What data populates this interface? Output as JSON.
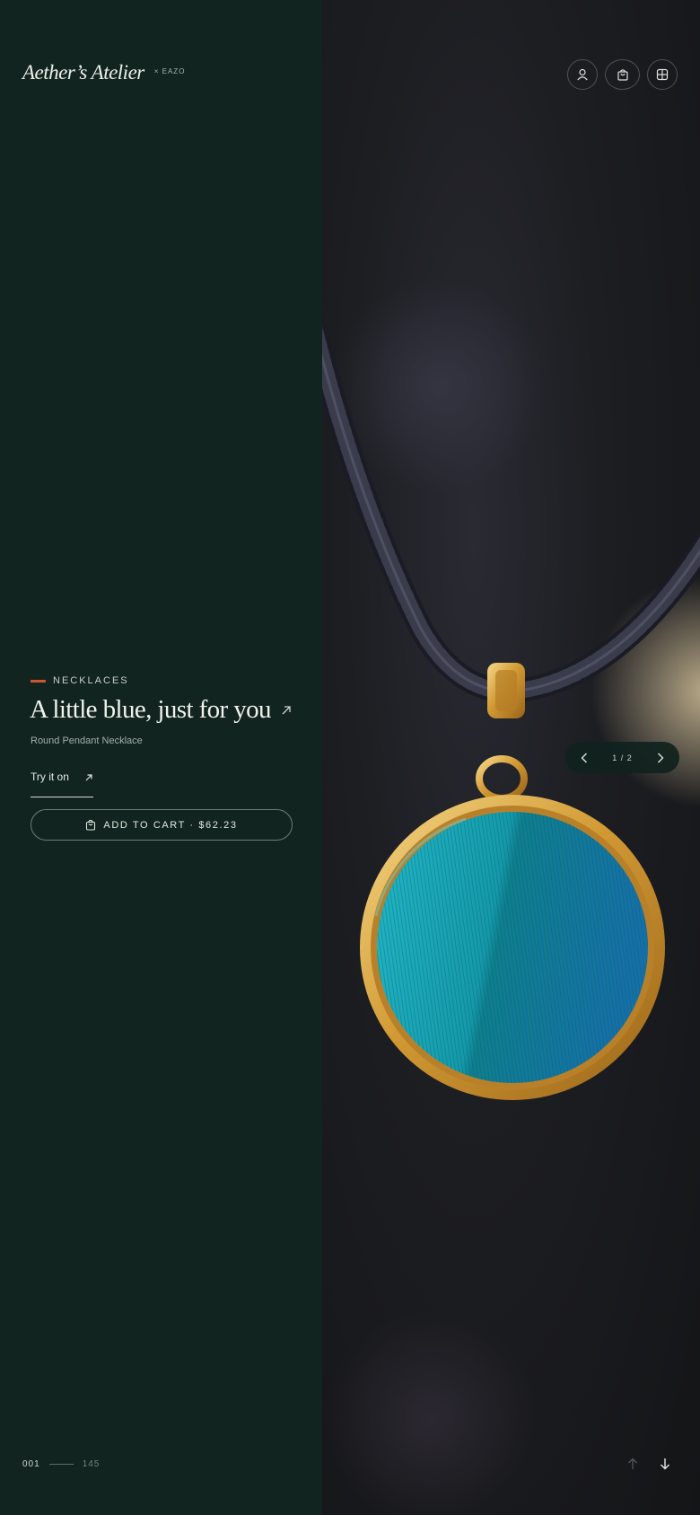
{
  "brand": {
    "name": "Aether’s Atelier",
    "tag": "× EAZO"
  },
  "product": {
    "category": "NECKLACES",
    "headline": "A little blue, just for you",
    "subtitle": "Round Pendant Necklace",
    "try_label": "Try it on",
    "cart_label": "ADD TO CART · $62.23"
  },
  "pager": {
    "current": "001",
    "total": "145"
  },
  "carousel": {
    "count": "1 / 2"
  },
  "icons": {
    "account": "user-icon",
    "bag": "shopping-bag-icon",
    "menu": "grid-icon",
    "prev": "chevron-left-icon",
    "next": "chevron-right-icon",
    "scroll_up": "arrow-up-icon",
    "scroll_down": "arrow-down-icon"
  },
  "colors": {
    "panel": "#11241f",
    "accent": "#d2542c",
    "gold": "#d9a741",
    "teal": "#1aa6b8"
  }
}
